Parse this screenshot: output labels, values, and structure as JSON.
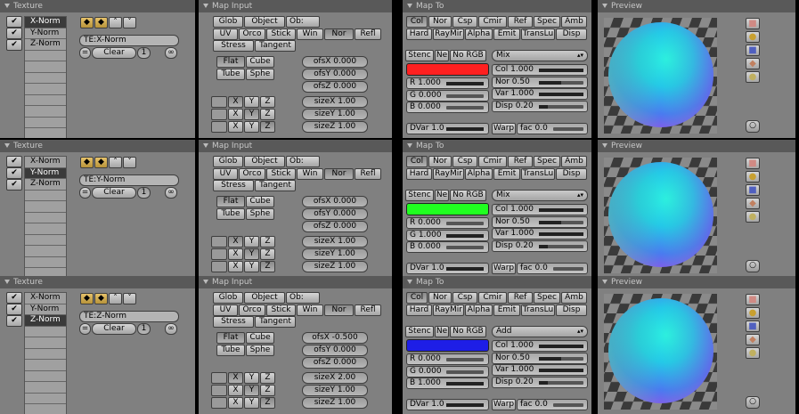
{
  "panel_titles": {
    "texture": "Texture",
    "map_input": "Map Input",
    "map_to": "Map To",
    "preview": "Preview"
  },
  "colors": {
    "red": "#ff2020",
    "green": "#20ff20",
    "blue": "#1e1ee6"
  },
  "icons": [
    "shield-arrow-icon",
    "shield-down-icon",
    "caret-up-icon",
    "caret-down-icon",
    "checkmark-icon",
    "material-icon",
    "sphere-icon",
    "cube-icon",
    "lamp-icon",
    "world-icon"
  ],
  "rows": [
    {
      "texture": {
        "channels": [
          "X-Norm",
          "Y-Norm",
          "Z-Norm"
        ],
        "selected": 0,
        "name": "TE:X-Norm",
        "clear": "Clear",
        "users": "1",
        "flags": {
          "up": "^",
          "down": "v"
        }
      },
      "map_input": {
        "coords": [
          "Glob",
          "Object",
          "Ob:"
        ],
        "maps": [
          "UV",
          "Orco",
          "Stick",
          "Win",
          "Nor",
          "Refl"
        ],
        "extras": [
          "Stress",
          "Tangent"
        ],
        "active": "Nor",
        "proj": [
          "Flat",
          "Cube",
          "Tube",
          "Sphe"
        ],
        "proj_active": "Flat",
        "xyz": [
          [
            "X",
            "Y",
            "Z"
          ],
          [
            "X",
            "Y",
            "Z"
          ],
          [
            "X",
            "Y",
            "Z"
          ]
        ],
        "ofs": [
          "ofsX 0.000",
          "ofsY 0.000",
          "ofsZ 0.000"
        ],
        "size": [
          "sizeX 1.00",
          "sizeY 1.00",
          "sizeZ 1.00"
        ]
      },
      "map_to": {
        "row1": [
          "Col",
          "Nor",
          "Csp",
          "Cmir",
          "Ref",
          "Spec",
          "Amb"
        ],
        "row2": [
          "Hard",
          "RayMir",
          "Alpha",
          "Emit",
          "TransLu",
          "Disp"
        ],
        "stencil": [
          "Stenc",
          "Ne",
          "No RGB"
        ],
        "blend": "Mix",
        "swatch": "red",
        "rgb": [
          "R 1.000",
          "G 0.000",
          "B 0.000"
        ],
        "rgb_vals": [
          1.0,
          0.0,
          0.0
        ],
        "facs": [
          "Col 1.000",
          "Nor 0.50",
          "Var 1.000",
          "Disp 0.20"
        ],
        "fac_vals": [
          1.0,
          0.5,
          1.0,
          0.2
        ],
        "dvar": "DVar 1.0",
        "warp": "Warp",
        "warpfac": "fac 0.0"
      },
      "preview": {}
    },
    {
      "texture": {
        "channels": [
          "X-Norm",
          "Y-Norm",
          "Z-Norm"
        ],
        "selected": 1,
        "name": "TE:Y-Norm",
        "clear": "Clear",
        "users": "1",
        "flags": {
          "up": "^",
          "down": "v"
        }
      },
      "map_input": {
        "coords": [
          "Glob",
          "Object",
          "Ob:"
        ],
        "maps": [
          "UV",
          "Orco",
          "Stick",
          "Win",
          "Nor",
          "Refl"
        ],
        "extras": [
          "Stress",
          "Tangent"
        ],
        "active": "Nor",
        "proj": [
          "Flat",
          "Cube",
          "Tube",
          "Sphe"
        ],
        "proj_active": "Flat",
        "xyz": [
          [
            "X",
            "Y",
            "Z"
          ],
          [
            "X",
            "Y",
            "Z"
          ],
          [
            "X",
            "Y",
            "Z"
          ]
        ],
        "ofs": [
          "ofsX 0.000",
          "ofsY 0.000",
          "ofsZ 0.000"
        ],
        "size": [
          "sizeX 1.00",
          "sizeY 1.00",
          "sizeZ 1.00"
        ]
      },
      "map_to": {
        "row1": [
          "Col",
          "Nor",
          "Csp",
          "Cmir",
          "Ref",
          "Spec",
          "Amb"
        ],
        "row2": [
          "Hard",
          "RayMir",
          "Alpha",
          "Emit",
          "TransLu",
          "Disp"
        ],
        "stencil": [
          "Stenc",
          "Ne",
          "No RGB"
        ],
        "blend": "Mix",
        "swatch": "green",
        "rgb": [
          "R 0.000",
          "G 1.000",
          "B 0.000"
        ],
        "rgb_vals": [
          0.0,
          1.0,
          0.0
        ],
        "facs": [
          "Col 1.000",
          "Nor 0.50",
          "Var 1.000",
          "Disp 0.20"
        ],
        "fac_vals": [
          1.0,
          0.5,
          1.0,
          0.2
        ],
        "dvar": "DVar 1.0",
        "warp": "Warp",
        "warpfac": "fac 0.0"
      },
      "preview": {}
    },
    {
      "texture": {
        "channels": [
          "X-Norm",
          "Y-Norm",
          "Z-Norm"
        ],
        "selected": 2,
        "name": "TE:Z-Norm",
        "clear": "Clear",
        "users": "1",
        "flags": {
          "up": "^",
          "down": "v"
        }
      },
      "map_input": {
        "coords": [
          "Glob",
          "Object",
          "Ob:"
        ],
        "maps": [
          "UV",
          "Orco",
          "Stick",
          "Win",
          "Nor",
          "Refl"
        ],
        "extras": [
          "Stress",
          "Tangent"
        ],
        "active": "Nor",
        "proj": [
          "Flat",
          "Cube",
          "Tube",
          "Sphe"
        ],
        "proj_active": "Flat",
        "xyz": [
          [
            "X",
            "Y",
            "Z"
          ],
          [
            "X",
            "Y",
            "Z"
          ],
          [
            "X",
            "Y",
            "Z"
          ]
        ],
        "ofs": [
          "ofsX -0.500",
          "ofsY 0.000",
          "ofsZ 0.000"
        ],
        "size": [
          "sizeX 2.00",
          "sizeY 1.00",
          "sizeZ 1.00"
        ]
      },
      "map_to": {
        "row1": [
          "Col",
          "Nor",
          "Csp",
          "Cmir",
          "Ref",
          "Spec",
          "Amb"
        ],
        "row2": [
          "Hard",
          "RayMir",
          "Alpha",
          "Emit",
          "TransLu",
          "Disp"
        ],
        "stencil": [
          "Stenc",
          "Ne",
          "No RGB"
        ],
        "blend": "Add",
        "swatch": "blue",
        "rgb": [
          "R 0.000",
          "G 0.000",
          "B 1.000"
        ],
        "rgb_vals": [
          0.0,
          0.0,
          1.0
        ],
        "facs": [
          "Col 1.000",
          "Nor 0.50",
          "Var 1.000",
          "Disp 0.20"
        ],
        "fac_vals": [
          1.0,
          0.5,
          1.0,
          0.2
        ],
        "dvar": "DVar 1.0",
        "warp": "Warp",
        "warpfac": "fac 0.0"
      },
      "preview": {}
    }
  ]
}
